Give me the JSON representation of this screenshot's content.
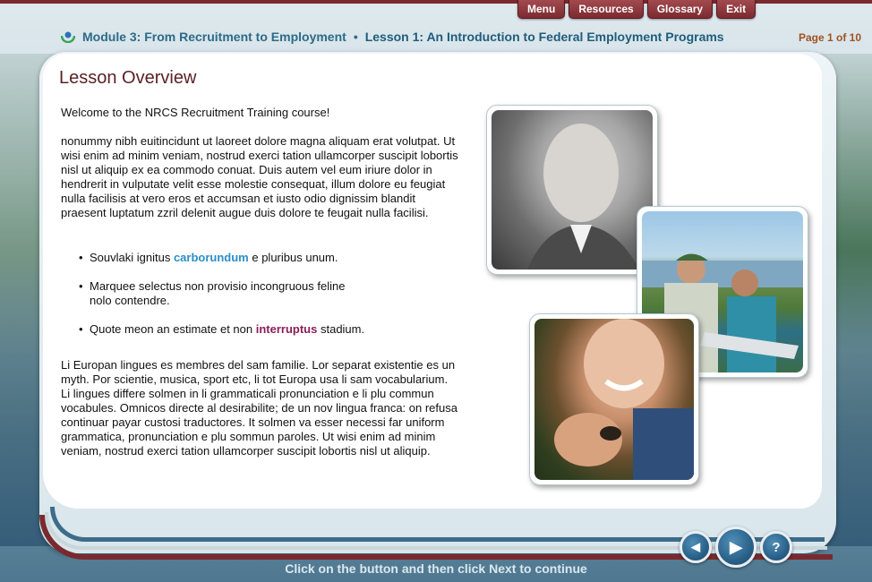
{
  "top_nav": {
    "menu": "Menu",
    "resources": "Resources",
    "glossary": "Glossary",
    "exit": "Exit"
  },
  "header": {
    "module": "Module 3: From Recruitment to Employment",
    "separator": "•",
    "lesson": "Lesson 1: An Introduction to Federal Employment Programs",
    "page_indicator": "Page 1 of 10"
  },
  "content": {
    "title": "Lesson Overview",
    "welcome": "Welcome to the NRCS Recruitment Training course!",
    "paragraph1": "nonummy nibh euitincidunt ut laoreet dolore magna aliquam erat volutpat. Ut wisi enim ad minim veniam, nostrud exerci tation ullamcorper suscipit lobortis nisl ut aliquip ex ea commodo conuat. Duis autem vel eum iriure dolor in hendrerit in vulputate velit esse molestie consequat, illum dolore eu feugiat nulla facilisis at vero eros et accumsan et iusto odio dignissim blandit praesent luptatum zzril delenit augue duis dolore te feugait nulla facilisi.",
    "bullets": [
      {
        "before": "Souvlaki ignitus ",
        "highlight": "carborundum",
        "after": " e pluribus unum."
      },
      {
        "before": "Marquee selectus non provisio incongruous feline nolo contendre.",
        "highlight": "",
        "after": ""
      },
      {
        "before": "Quote meon an estimate et non ",
        "highlight": "interruptus",
        "after": " stadium."
      }
    ],
    "paragraph2": "Li Europan lingues es membres del sam familie. Lor separat existentie es un myth. Por scientie, musica, sport etc, li tot Europa usa li sam vocabularium. Li lingues differe solmen in li grammaticali pronunciation e li plu commun vocabules. Omnicos directe al desirabilite; de un nov lingua franca: on refusa continuar payar custosi traductores. It solmen va esser necessi far uniform grammatica, pronunciation e plu sommun paroles. Ut wisi enim ad minim veniam, nostrud exerci tation ullamcorper suscipit lobortis nisl ut aliquip."
  },
  "footer": {
    "back_icon": "◀",
    "next_icon": "▶",
    "help_icon": "?",
    "instruction": "Click on the button and then click Next to continue"
  },
  "colors": {
    "brand_maroon": "#7a2a2e",
    "header_blue": "#2d6a86",
    "page_indicator": "#a0521e",
    "highlight_blue": "#2b8fc4",
    "highlight_purple": "#8a1f5a"
  }
}
